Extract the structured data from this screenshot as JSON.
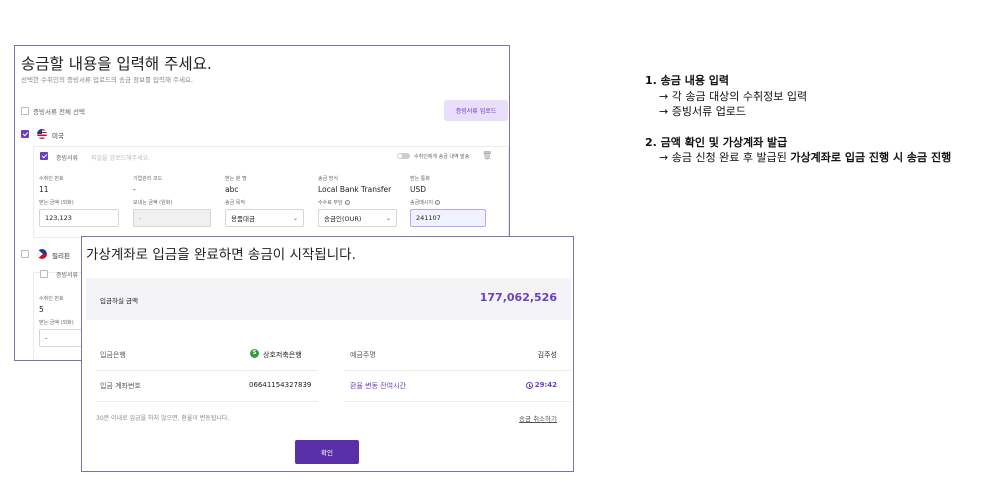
{
  "form": {
    "title": "송금할 내용을 입력해 주세요.",
    "subtitle": "선택한 수취인의 증빙서류 업로드의 송금 정보를 입력해 주세요.",
    "select_all_label": "증빙서류 전체 선택",
    "upload_button": "증빙서류 업로드",
    "countries": [
      {
        "name": "미국"
      },
      {
        "name": "필리핀"
      }
    ],
    "card_us": {
      "doc_label": "증빙서류",
      "doc_placeholder": "파일을 업로드해주세요.",
      "toggle_label": "수취인에게 송금 내역 발송",
      "fields": [
        {
          "label": "수취인 번호",
          "value": "11"
        },
        {
          "label": "기업관리 코드",
          "value": "-"
        },
        {
          "label": "받는 분 명",
          "value": "abc"
        },
        {
          "label": "송금 방식",
          "value": "Local Bank Transfer"
        },
        {
          "label": "받는 통화",
          "value": "USD"
        }
      ],
      "inputs": [
        {
          "label": "받는 금액 (외화)",
          "value": "123,123"
        },
        {
          "label": "보내는 금액 (원화)",
          "value": "-"
        },
        {
          "label": "송금 목적",
          "value": "용품대금"
        },
        {
          "label": "수수료 부담",
          "value": "송금인(OUR)"
        },
        {
          "label": "송금메시지",
          "value": "241107"
        }
      ]
    },
    "card_ph": {
      "doc_label": "증빙서류",
      "fields": [
        {
          "label": "수취인 번호",
          "value": "5"
        },
        {
          "label": "받는 금액 (외화)",
          "value": "-"
        }
      ]
    }
  },
  "modal": {
    "title": "가상계좌로 입금을 완료하면 송금이 시작됩니다.",
    "amount_label": "입금하실 금액",
    "amount_value": "177,062,526",
    "bank_label": "입금은행",
    "bank_name": "상호저축은행",
    "holder_label": "예금주명",
    "holder_name": "김주성",
    "account_label": "입금 계좌번호",
    "account_number": "06641154327839",
    "rate_label": "환율 변동 잔여시간",
    "time_left": "29:42",
    "notice": "30분 이내로 입금을 하지 않으면, 환율이 변동됩니다.",
    "cancel_link": "송금 취소하기",
    "confirm_button": "확인"
  },
  "notes": {
    "step1_title": "1. 송금 내용 입력",
    "step1_items": [
      "→ 각 송금 대상의 수취정보 입력",
      "→ 증빙서류 업로드"
    ],
    "step2_title": "2. 금액 확인 및 가상계좌 발급",
    "step2_prefix": "→ 송금 신청 완료 후  발급된 ",
    "step2_bold": "가상계좌로 입금 진행 시 송금 진행"
  },
  "colors": {
    "accent": "#6a3fc4",
    "button": "#5b2fa8",
    "border": "#7b70b8"
  }
}
